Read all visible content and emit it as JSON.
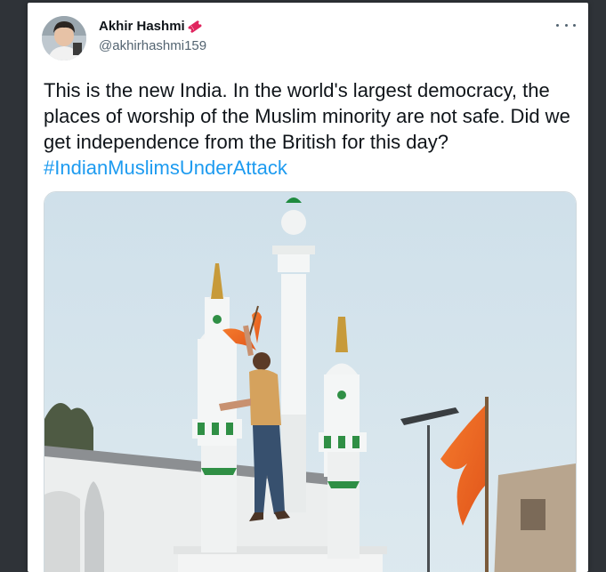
{
  "tweet": {
    "author": {
      "display_name": "Akhir Hashmi",
      "handle": "@akhirhashmi159"
    },
    "more_label": "···",
    "text_before_hashtag": "This is the new India. In the world's largest democracy, the places of worship of the Muslim minority are not safe. Did we get independence from the British for this day?",
    "hashtag": "#IndianMuslimsUnderAttack",
    "media": {
      "icon": "photo"
    }
  },
  "colors": {
    "link": "#1d9bf0",
    "text": "#0f1419",
    "secondary": "#536471",
    "flag": "#f26b1d"
  }
}
